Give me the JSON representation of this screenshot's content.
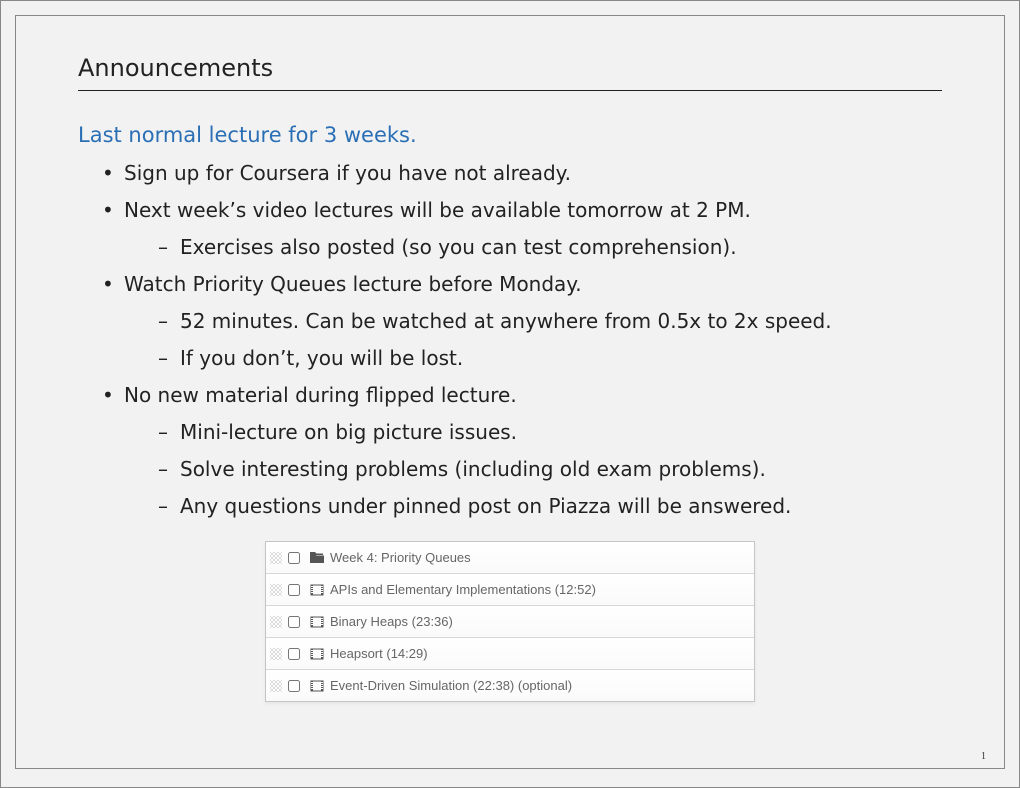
{
  "title": "Announcements",
  "subhead": "Last normal lecture for 3 weeks.",
  "bullets": [
    {
      "text": "Sign up for Coursera if you have not already."
    },
    {
      "text": "Next week’s video lectures will be available tomorrow at 2 PM.",
      "sub": [
        "Exercises also posted (so you can test comprehension)."
      ]
    },
    {
      "text": "Watch Priority Queues lecture before Monday.",
      "sub": [
        "52 minutes. Can be watched at anywhere from 0.5x to 2x speed.",
        "If you don’t, you will be lost."
      ]
    },
    {
      "text": "No new material during flipped lecture.",
      "sub": [
        "Mini-lecture on big picture issues.",
        "Solve interesting problems (including old exam problems).",
        "Any questions under pinned post on Piazza will be answered."
      ]
    }
  ],
  "video_rows": [
    {
      "type": "folder",
      "label": "Week 4:  Priority Queues"
    },
    {
      "type": "video",
      "label": "APIs and Elementary Implementations (12:52)"
    },
    {
      "type": "video",
      "label": "Binary Heaps (23:36)"
    },
    {
      "type": "video",
      "label": "Heapsort (14:29)"
    },
    {
      "type": "video",
      "label": "Event-Driven Simulation (22:38) (optional)"
    }
  ],
  "page_number": "1"
}
